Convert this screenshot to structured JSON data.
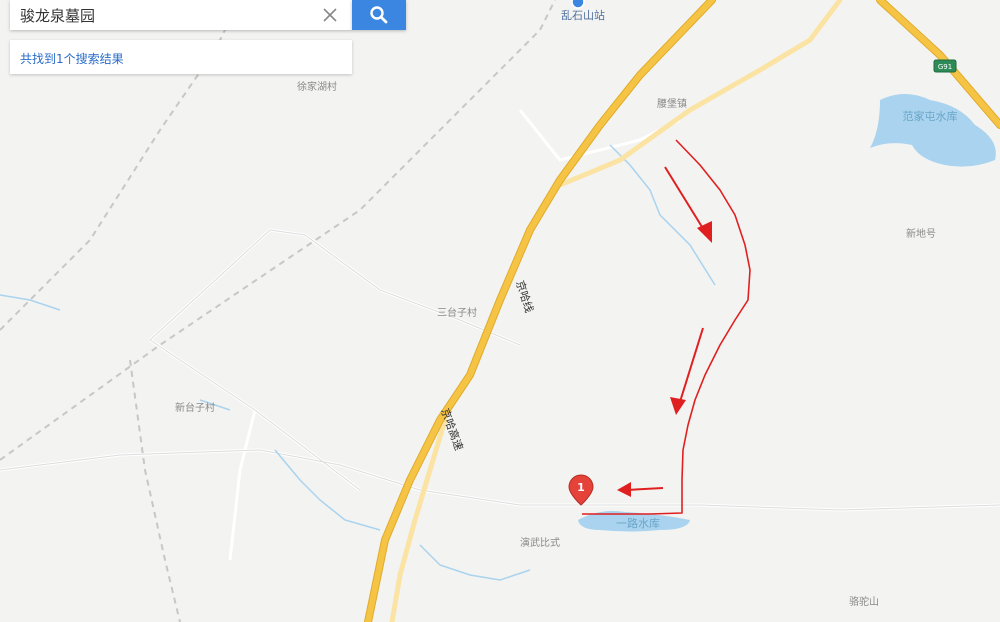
{
  "search": {
    "value": "骏龙泉墓园",
    "results_text": "共找到1个搜索结果"
  },
  "icons": {
    "clear": "close-icon",
    "search": "search-icon",
    "station": "train-station-icon",
    "marker": "map-pin-icon"
  },
  "map": {
    "labels": {
      "station": "乱石山站",
      "xujiahu": "徐家湖村",
      "yaobao": "腰堡镇",
      "fanjiatun": "范家屯水库",
      "xindihao": "新地号",
      "santaizi": "三台子村",
      "xintaizi": "新台子村",
      "yanwu": "演武比式",
      "yilu": "一路水库",
      "luotuoshan": "骆驼山",
      "railway": "京哈线",
      "expressway": "京哈高速",
      "expressway_code": "G91"
    },
    "marker_number": "1",
    "colors": {
      "background": "#f3f3f1",
      "expressway": "#f6c445",
      "arterial": "#fbe3a3",
      "water": "#a9d3ee",
      "route_annotation": "#e02020",
      "marker": "#e5423a",
      "search_button": "#3a86e0"
    }
  }
}
